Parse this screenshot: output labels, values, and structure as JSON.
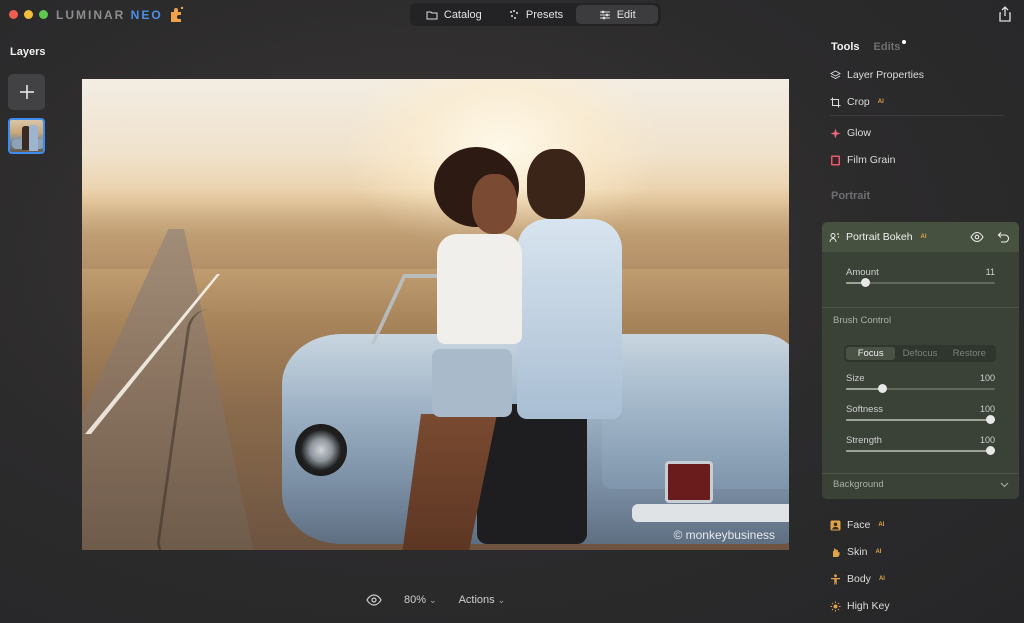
{
  "app": {
    "brand_part1": "LUMINAR",
    "brand_part2": "NEO",
    "window_controls": [
      "close",
      "minimize",
      "zoom"
    ]
  },
  "nav": {
    "tabs": [
      {
        "label": "Catalog",
        "icon": "folder-icon",
        "active": false
      },
      {
        "label": "Presets",
        "icon": "presets-icon",
        "active": false
      },
      {
        "label": "Edit",
        "icon": "sliders-icon",
        "active": true
      }
    ],
    "share_icon": "share-icon"
  },
  "layers": {
    "title": "Layers",
    "add_icon": "plus-icon"
  },
  "canvas": {
    "watermark": "© monkeybusiness"
  },
  "bottom_bar": {
    "zoom": "80%",
    "actions": "Actions"
  },
  "right_panel": {
    "tab_tools": "Tools",
    "tab_edits": "Edits",
    "essentials": [
      {
        "label": "Layer Properties",
        "ai": false,
        "icon": "layers-icon"
      },
      {
        "label": "Crop",
        "ai": true,
        "icon": "crop-icon"
      }
    ],
    "creative": [
      {
        "label": "Glow",
        "ai": false,
        "icon": "glow-icon"
      },
      {
        "label": "Film Grain",
        "ai": false,
        "icon": "film-icon"
      }
    ],
    "section_portrait": "Portrait",
    "portrait_bokeh": {
      "title": "Portrait Bokeh",
      "ai_badge": "AI",
      "amount_label": "Amount",
      "amount_value": "11",
      "brush_control": "Brush Control",
      "modes": [
        "Focus",
        "Defocus",
        "Restore"
      ],
      "active_mode": "Focus",
      "size_label": "Size",
      "size_value": "100",
      "softness_label": "Softness",
      "softness_value": "100",
      "strength_label": "Strength",
      "strength_value": "100",
      "background_label": "Background"
    },
    "portrait_tools": [
      {
        "label": "Face",
        "ai": true,
        "icon": "face-icon"
      },
      {
        "label": "Skin",
        "ai": true,
        "icon": "skin-icon"
      },
      {
        "label": "Body",
        "ai": true,
        "icon": "body-icon"
      },
      {
        "label": "High Key",
        "ai": false,
        "icon": "highkey-icon"
      }
    ],
    "ai_badge": "AI"
  },
  "colors": {
    "accent_blue": "#3d8cf0",
    "ai_orange": "#e0a24a",
    "bokeh_panel": "#3a4237"
  },
  "slider_levels": {
    "amount": 0.11,
    "size": 0.25,
    "softness": 1.0,
    "strength": 1.0
  }
}
